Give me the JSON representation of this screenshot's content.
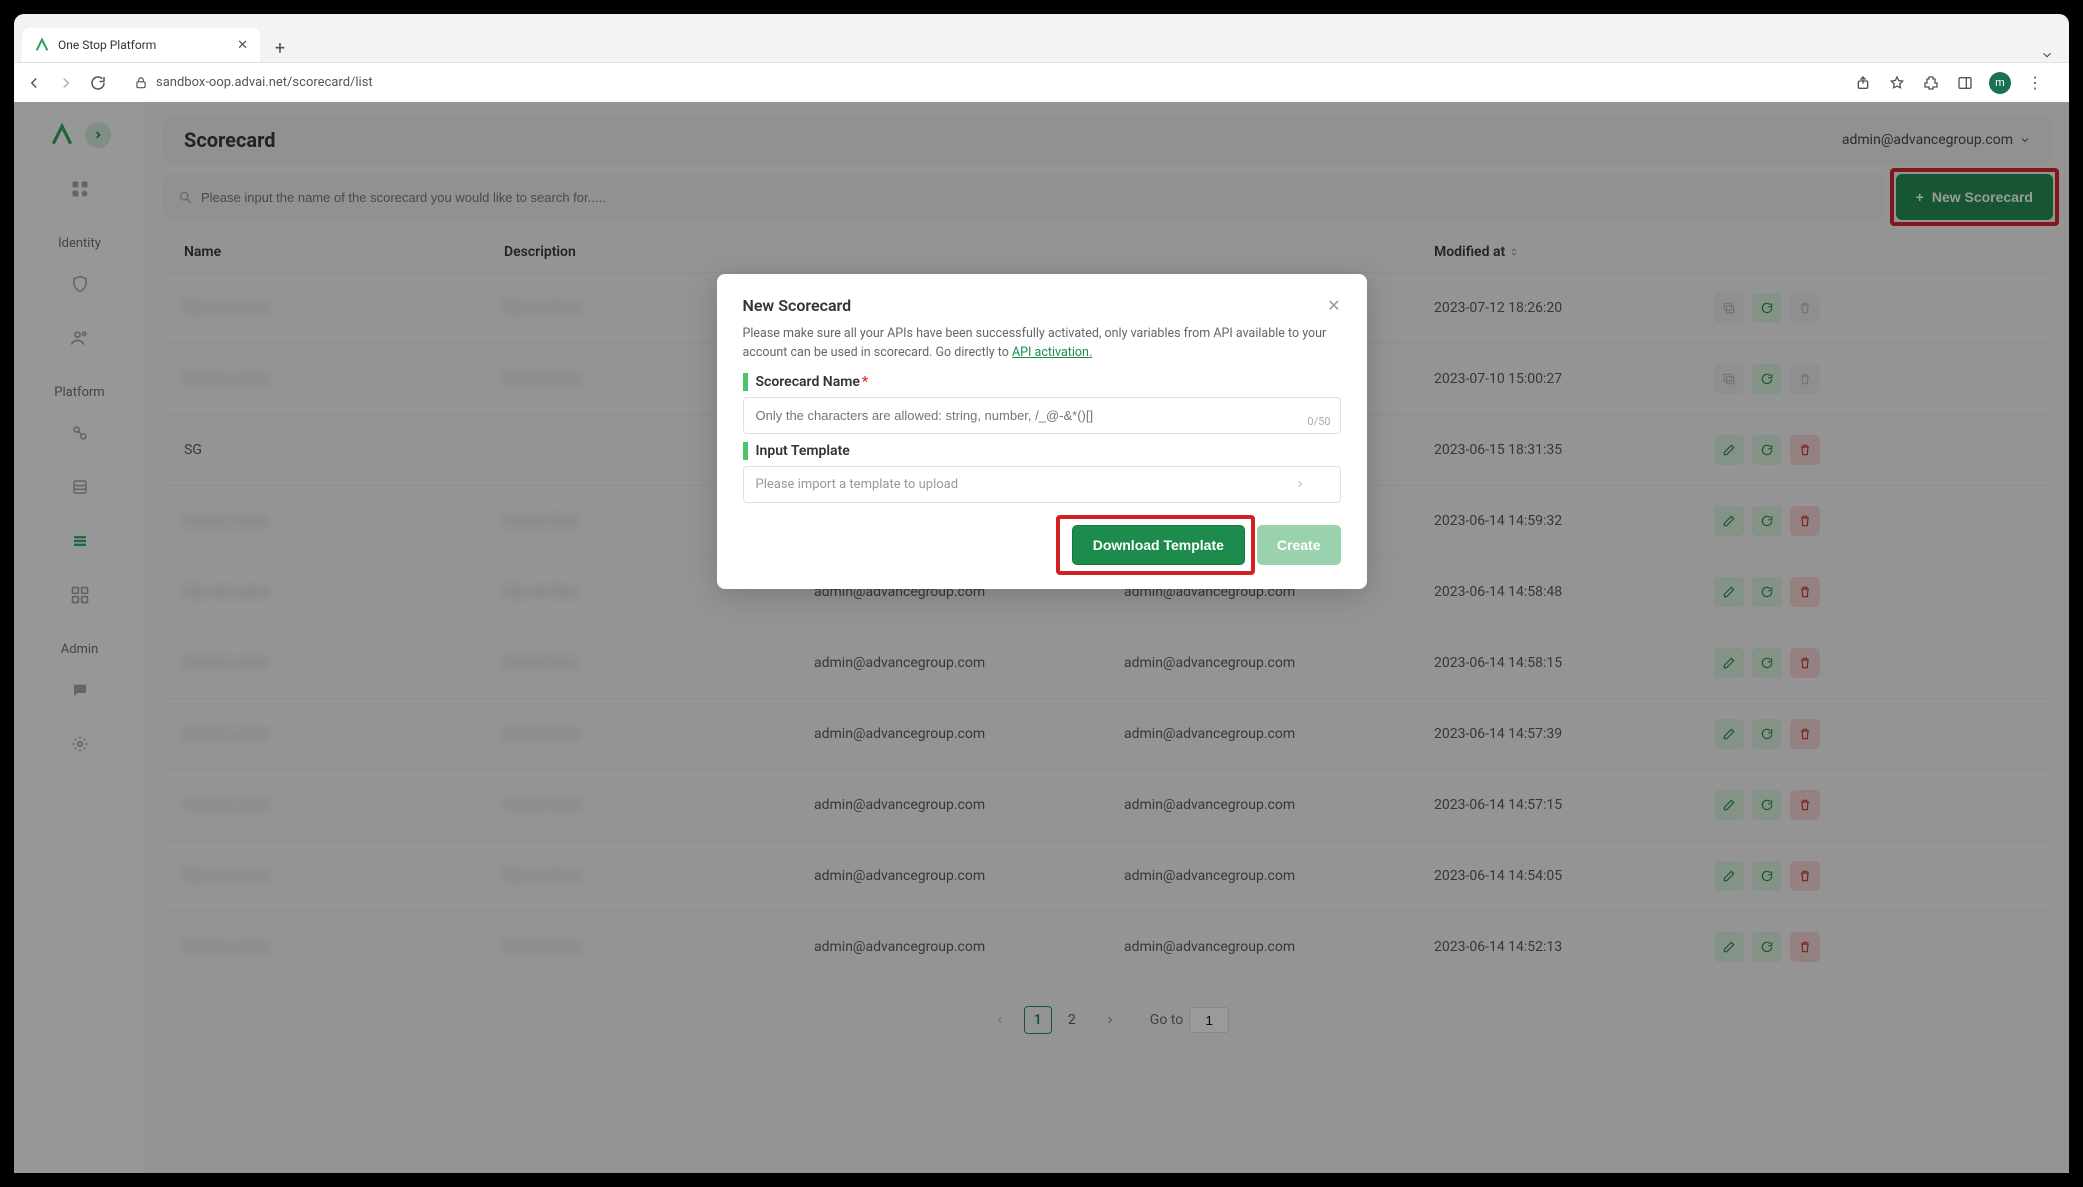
{
  "browser": {
    "tab_title": "One Stop Platform",
    "url": "sandbox-oop.advai.net/scorecard/list",
    "avatar_initial": "m"
  },
  "sidebar": {
    "sections": [
      "Identity",
      "Platform",
      "Admin"
    ]
  },
  "header": {
    "page_title": "Scorecard",
    "user_email": "admin@advancegroup.com"
  },
  "toolbar": {
    "search_placeholder": "Please input the name of the scorecard you would like to search for.....",
    "new_label": "New Scorecard"
  },
  "table": {
    "columns": [
      "Name",
      "Description",
      "",
      "",
      "Modified at"
    ],
    "rows": [
      {
        "name": "blurred_name",
        "desc": "blurred desc",
        "c3": "",
        "c4": "",
        "modified": "2023-07-12 18:26:20",
        "row_type": "a"
      },
      {
        "name": "blurred_name",
        "desc": "blurred desc",
        "c3": "",
        "c4": "",
        "modified": "2023-07-10 15:00:27",
        "row_type": "a"
      },
      {
        "name": "SG",
        "desc": "",
        "c3": "",
        "c4": "",
        "modified": "2023-06-15 18:31:35",
        "row_type": "b"
      },
      {
        "name": "blurred_name",
        "desc": "blurred desc",
        "c3": "",
        "c4": "",
        "modified": "2023-06-14 14:59:32",
        "row_type": "b"
      },
      {
        "name": "blurred_name",
        "desc": "blurred desc",
        "c3": "admin@advancegroup.com",
        "c4": "admin@advancegroup.com",
        "modified": "2023-06-14 14:58:48",
        "row_type": "b"
      },
      {
        "name": "blurred_name",
        "desc": "blurred desc",
        "c3": "admin@advancegroup.com",
        "c4": "admin@advancegroup.com",
        "modified": "2023-06-14 14:58:15",
        "row_type": "b"
      },
      {
        "name": "blurred_name",
        "desc": "blurred desc",
        "c3": "admin@advancegroup.com",
        "c4": "admin@advancegroup.com",
        "modified": "2023-06-14 14:57:39",
        "row_type": "b"
      },
      {
        "name": "blurred_name",
        "desc": "blurred desc",
        "c3": "admin@advancegroup.com",
        "c4": "admin@advancegroup.com",
        "modified": "2023-06-14 14:57:15",
        "row_type": "b"
      },
      {
        "name": "blurred_name",
        "desc": "blurred desc",
        "c3": "admin@advancegroup.com",
        "c4": "admin@advancegroup.com",
        "modified": "2023-06-14 14:54:05",
        "row_type": "b"
      },
      {
        "name": "blurred_name",
        "desc": "blurred desc",
        "c3": "admin@advancegroup.com",
        "c4": "admin@advancegroup.com",
        "modified": "2023-06-14 14:52:13",
        "row_type": "b"
      }
    ]
  },
  "pagination": {
    "pages": [
      "1",
      "2"
    ],
    "active": "1",
    "goto_label": "Go to",
    "goto_value": "1"
  },
  "modal": {
    "title": "New Scorecard",
    "notice_pre": "Please make sure all your APIs have been successfully activated, only variables from API available to your account can be used in scorecard. Go directly to ",
    "notice_link": "API activation.",
    "field_name_label": "Scorecard Name",
    "name_placeholder": "Only the characters are allowed: string, number, /_@-&*()[]",
    "char_count": "0/50",
    "field_template_label": "Input Template",
    "template_placeholder": "Please import a template to upload",
    "download_label": "Download Template",
    "create_label": "Create"
  }
}
